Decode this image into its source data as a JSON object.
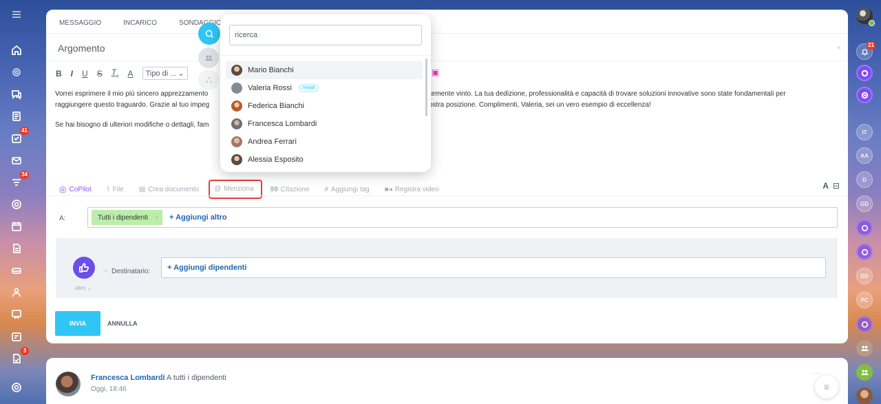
{
  "left_sidebar": {
    "items": [
      {
        "icon": "menu-icon",
        "badge": ""
      },
      {
        "icon": "home-icon",
        "badge": ""
      },
      {
        "icon": "copilot-icon",
        "badge": ""
      },
      {
        "icon": "chat-icon",
        "badge": ""
      },
      {
        "icon": "news-icon",
        "badge": ""
      },
      {
        "icon": "tasks-icon",
        "badge": "41"
      },
      {
        "icon": "mail-icon",
        "badge": ""
      },
      {
        "icon": "crm-icon",
        "badge": "34"
      },
      {
        "icon": "automation-icon",
        "badge": ""
      },
      {
        "icon": "calendar-icon",
        "badge": ""
      },
      {
        "icon": "documents-icon",
        "badge": ""
      },
      {
        "icon": "drive-icon",
        "badge": ""
      },
      {
        "icon": "groups-icon",
        "badge": ""
      },
      {
        "icon": "boards-icon",
        "badge": ""
      },
      {
        "icon": "booking-icon",
        "badge": ""
      },
      {
        "icon": "sign-icon",
        "badge": "3"
      },
      {
        "icon": "settings-icon",
        "badge": ""
      }
    ]
  },
  "right_sidebar": {
    "notifications_badge": "21",
    "initials": [
      "IT",
      "AA",
      "D",
      "GD",
      "DD",
      "PC"
    ]
  },
  "composer": {
    "tabs": [
      "MESSAGGIO",
      "INCARICO",
      "SONDAGGIO"
    ],
    "subject_placeholder": "Argomento",
    "subject_close": "×",
    "format_select": "Tipo di ...",
    "body_line1_left": "Vorrei esprimere il mio più sincero apprezzamento",
    "body_line1_right": "temente vinto. La tua dedizione, professionalità e capacità di trovare soluzioni innovative sono state fondamentali per",
    "body_line2_left": "raggiungere questo traguardo. Grazie al tuo impeg",
    "body_line2_right": "ostra posizione. Complimenti, Valeria, sei un vero esempio di eccellenza!",
    "body_line3_left": "Se hai bisogno di ulteriori modifiche o dettagli, fam",
    "bottom_toolbar": {
      "copilot": "CoPilot",
      "file": "File",
      "create_doc": "Crea documento",
      "mention": "Menziona",
      "quote": "Citazione",
      "tag": "Aggiungi tag",
      "video": "Registra video",
      "font_toggle": "A"
    },
    "to_label": "A:",
    "to_chip": "Tutti i dipendenti",
    "to_chip_remove": "×",
    "add_more": "+ Aggiungi altro",
    "recipient_label": "Destinatario:",
    "recipient_arrow": "→",
    "recipient_add": "+ Aggiungi dipendenti",
    "altro": "altro",
    "send": "INVIA",
    "cancel": "ANNULLA"
  },
  "mention_popup": {
    "search_placeholder": "ricerca",
    "people": [
      {
        "name": "Mario Bianchi",
        "invited": "",
        "color": "#8c6a55"
      },
      {
        "name": "Valeria Rossi",
        "invited": "Invitati",
        "color": "#828b95"
      },
      {
        "name": "Federica Bianchi",
        "invited": "",
        "color": "#b65a2a"
      },
      {
        "name": "Francesca Lombardi",
        "invited": "",
        "color": "#6d6f7a"
      },
      {
        "name": "Andrea Ferrari",
        "invited": "",
        "color": "#a0776a"
      },
      {
        "name": "Alessia Esposito",
        "invited": "",
        "color": "#9a7f6a"
      }
    ]
  },
  "feed_post": {
    "author": "Francesca Lombardi",
    "chevron": ">",
    "target": "A tutti i dipendenti",
    "time": "Oggi, 18:46",
    "dots": "···",
    "menu_icon": "≡"
  }
}
